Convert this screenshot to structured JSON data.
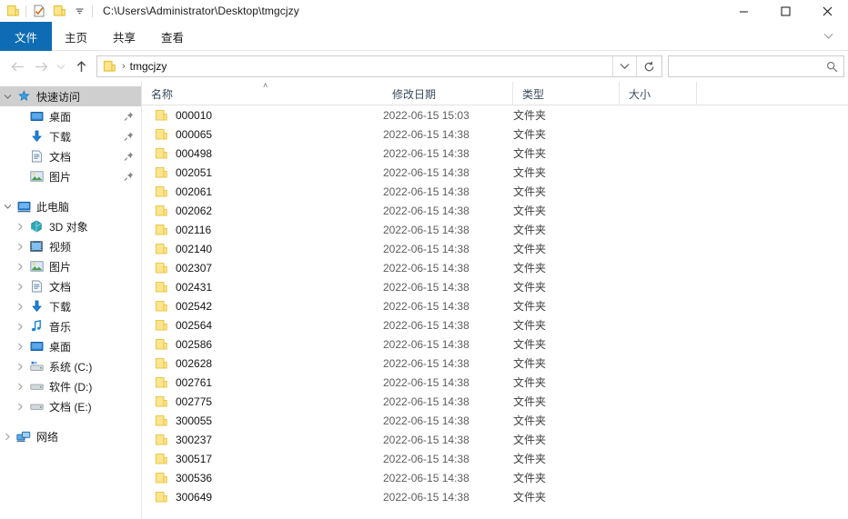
{
  "window": {
    "title_path": "C:\\Users\\Administrator\\Desktop\\tmgcjzy",
    "quick_access_toolbar": [
      {
        "name": "folder-properties-icon",
        "label": ""
      },
      {
        "name": "new-folder-icon",
        "label": ""
      },
      {
        "name": "qat-dropdown-icon",
        "label": ""
      }
    ],
    "controls": {
      "minimize": "─",
      "maximize": "□",
      "close": "✕"
    }
  },
  "ribbon": {
    "tabs": [
      {
        "label": "文件",
        "active": true
      },
      {
        "label": "主页",
        "active": false
      },
      {
        "label": "共享",
        "active": false
      },
      {
        "label": "查看",
        "active": false
      }
    ],
    "expand_icon": "chevron-down-icon"
  },
  "navigation": {
    "back_tooltip": "后退",
    "forward_tooltip": "前进",
    "recent_tooltip": "最近位置",
    "up_tooltip": "上一级",
    "breadcrumb": [
      "tmgcjzy"
    ],
    "breadcrumb_separator": "›",
    "refresh_tooltip": "刷新",
    "search": {
      "value": "",
      "placeholder": ""
    }
  },
  "sidebar": {
    "groups": [
      {
        "name": "quick-access",
        "label": "快速访问",
        "icon": "pin-star-icon",
        "selected": true,
        "expanded": true,
        "items": [
          {
            "label": "桌面",
            "icon": "desktop-icon",
            "pinned": true
          },
          {
            "label": "下载",
            "icon": "download-icon",
            "pinned": true
          },
          {
            "label": "文档",
            "icon": "documents-icon",
            "pinned": true
          },
          {
            "label": "图片",
            "icon": "pictures-icon",
            "pinned": true
          }
        ]
      },
      {
        "name": "this-pc",
        "label": "此电脑",
        "icon": "this-pc-icon",
        "selected": false,
        "expanded": true,
        "items": [
          {
            "label": "3D 对象",
            "icon": "3d-objects-icon",
            "pinned": false
          },
          {
            "label": "视频",
            "icon": "videos-icon",
            "pinned": false
          },
          {
            "label": "图片",
            "icon": "pictures-icon",
            "pinned": false
          },
          {
            "label": "文档",
            "icon": "documents-icon",
            "pinned": false
          },
          {
            "label": "下载",
            "icon": "download-icon",
            "pinned": false
          },
          {
            "label": "音乐",
            "icon": "music-icon",
            "pinned": false
          },
          {
            "label": "桌面",
            "icon": "desktop-icon",
            "pinned": false
          },
          {
            "label": "系统 (C:)",
            "icon": "system-drive-icon",
            "pinned": false
          },
          {
            "label": "软件 (D:)",
            "icon": "drive-icon",
            "pinned": false
          },
          {
            "label": "文档 (E:)",
            "icon": "drive-icon",
            "pinned": false
          }
        ]
      },
      {
        "name": "network",
        "label": "网络",
        "icon": "network-icon",
        "selected": false,
        "expanded": false,
        "items": []
      }
    ]
  },
  "file_list": {
    "columns": [
      {
        "key": "name",
        "label": "名称",
        "sorted": "asc"
      },
      {
        "key": "date",
        "label": "修改日期",
        "sorted": ""
      },
      {
        "key": "type",
        "label": "类型",
        "sorted": ""
      },
      {
        "key": "size",
        "label": "大小",
        "sorted": ""
      }
    ],
    "sort_indicator": "˄",
    "rows": [
      {
        "name": "000010",
        "date": "2022-06-15 15:03",
        "type": "文件夹",
        "size": ""
      },
      {
        "name": "000065",
        "date": "2022-06-15 14:38",
        "type": "文件夹",
        "size": ""
      },
      {
        "name": "000498",
        "date": "2022-06-15 14:38",
        "type": "文件夹",
        "size": ""
      },
      {
        "name": "002051",
        "date": "2022-06-15 14:38",
        "type": "文件夹",
        "size": ""
      },
      {
        "name": "002061",
        "date": "2022-06-15 14:38",
        "type": "文件夹",
        "size": ""
      },
      {
        "name": "002062",
        "date": "2022-06-15 14:38",
        "type": "文件夹",
        "size": ""
      },
      {
        "name": "002116",
        "date": "2022-06-15 14:38",
        "type": "文件夹",
        "size": ""
      },
      {
        "name": "002140",
        "date": "2022-06-15 14:38",
        "type": "文件夹",
        "size": ""
      },
      {
        "name": "002307",
        "date": "2022-06-15 14:38",
        "type": "文件夹",
        "size": ""
      },
      {
        "name": "002431",
        "date": "2022-06-15 14:38",
        "type": "文件夹",
        "size": ""
      },
      {
        "name": "002542",
        "date": "2022-06-15 14:38",
        "type": "文件夹",
        "size": ""
      },
      {
        "name": "002564",
        "date": "2022-06-15 14:38",
        "type": "文件夹",
        "size": ""
      },
      {
        "name": "002586",
        "date": "2022-06-15 14:38",
        "type": "文件夹",
        "size": ""
      },
      {
        "name": "002628",
        "date": "2022-06-15 14:38",
        "type": "文件夹",
        "size": ""
      },
      {
        "name": "002761",
        "date": "2022-06-15 14:38",
        "type": "文件夹",
        "size": ""
      },
      {
        "name": "002775",
        "date": "2022-06-15 14:38",
        "type": "文件夹",
        "size": ""
      },
      {
        "name": "300055",
        "date": "2022-06-15 14:38",
        "type": "文件夹",
        "size": ""
      },
      {
        "name": "300237",
        "date": "2022-06-15 14:38",
        "type": "文件夹",
        "size": ""
      },
      {
        "name": "300517",
        "date": "2022-06-15 14:38",
        "type": "文件夹",
        "size": ""
      },
      {
        "name": "300536",
        "date": "2022-06-15 14:38",
        "type": "文件夹",
        "size": ""
      },
      {
        "name": "300649",
        "date": "2022-06-15 14:38",
        "type": "文件夹",
        "size": ""
      }
    ]
  },
  "colors": {
    "accent": "#0d6cb3",
    "folder_fill": "#ffe08a",
    "folder_stroke": "#e8b827",
    "selected_nav": "#cfcfcf",
    "header_text": "#3a4b5c",
    "date_text": "#5d5d5d"
  }
}
